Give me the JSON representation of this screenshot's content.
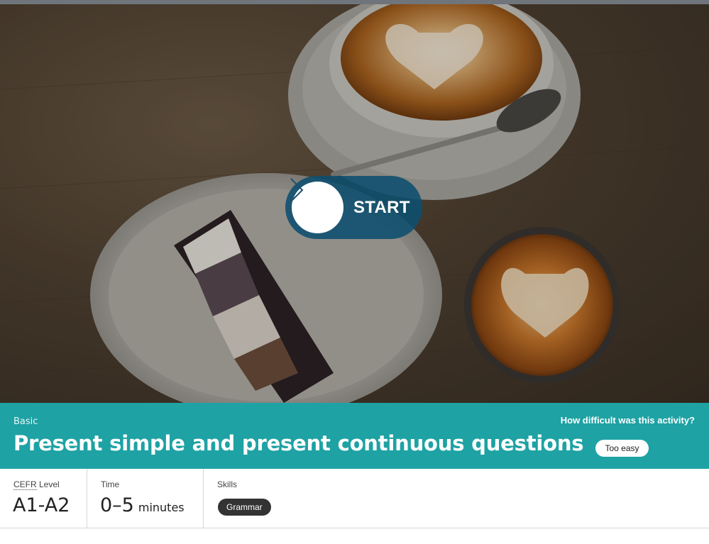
{
  "hero": {
    "image_description_icon": "coffee-and-cake-photo",
    "start_label": "START"
  },
  "activity": {
    "level": "Basic",
    "title": "Present simple and present continuous questions",
    "difficulty_question": "How difficult was this activity?",
    "difficulty_answer": "Too easy"
  },
  "info": {
    "cefr_abbr": "CEFR",
    "cefr_label_suffix": " Level",
    "cefr_value": "A1-A2",
    "time_label": "Time",
    "time_value": "0–5",
    "time_unit": "minutes",
    "skills_label": "Skills",
    "skills": [
      "Grammar"
    ]
  },
  "colors": {
    "banner": "#1ea2a4",
    "start_button": "#0c4e6e",
    "skill_tag": "#333333"
  }
}
